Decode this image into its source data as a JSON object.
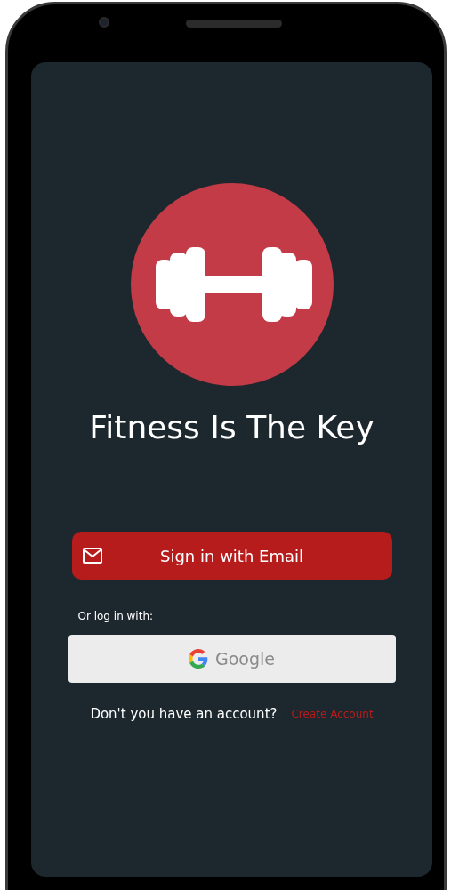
{
  "app_title": "Fitness Is The Key",
  "email_button": {
    "label": "Sign in with Email"
  },
  "alt_login_label": "Or log in with:",
  "google_button": {
    "label": "Google"
  },
  "signup_prompt": {
    "text": "Don't you have an account?",
    "link": "Create Account"
  }
}
